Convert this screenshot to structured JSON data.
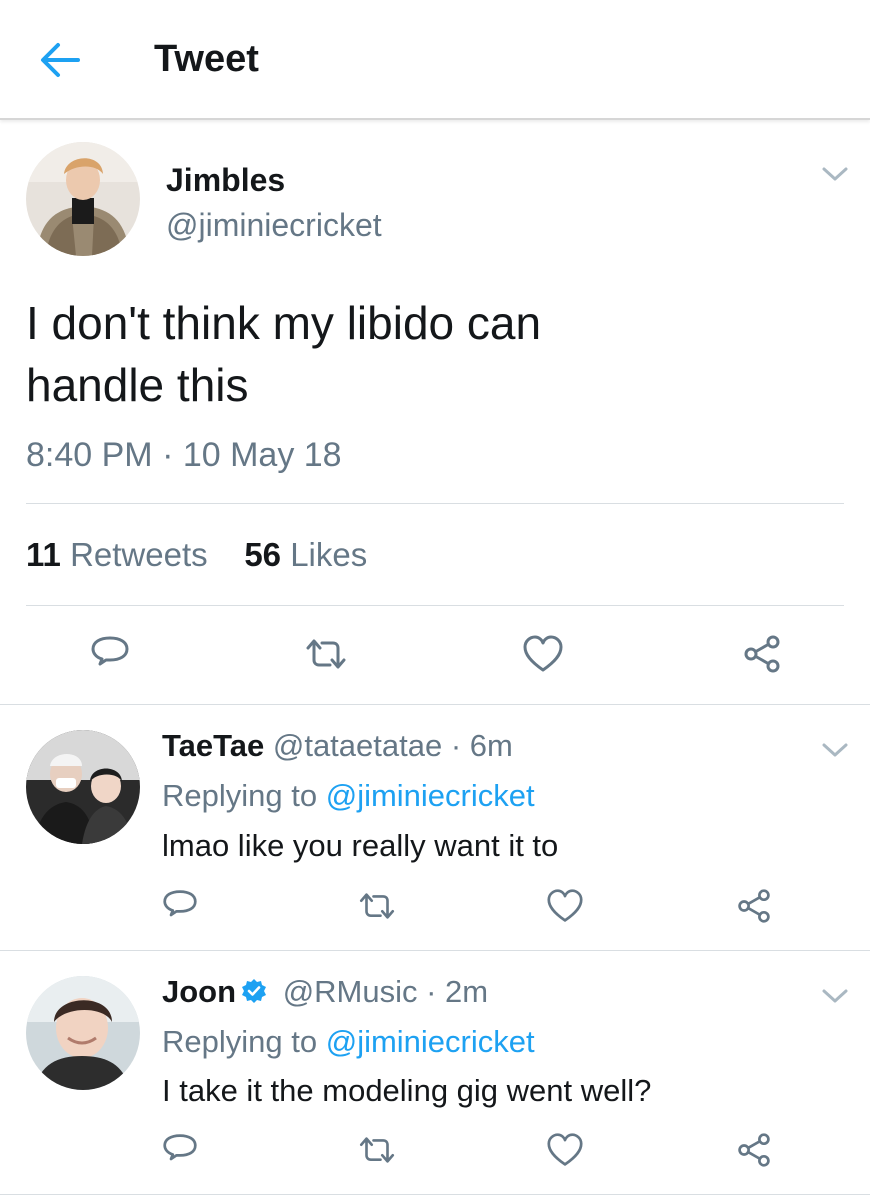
{
  "header": {
    "title": "Tweet",
    "back_icon": "arrow-left-icon",
    "accent": "#1da1f2"
  },
  "tweet": {
    "display_name": "Jimbles",
    "handle": "@jiminiecricket",
    "text_line1": "I don't think my libido can",
    "text_line2": "handle this",
    "timestamp": "8:40 PM · 10 May 18",
    "retweets_count": "11",
    "retweets_label": "Retweets",
    "likes_count": "56",
    "likes_label": "Likes"
  },
  "actions": [
    "reply-icon",
    "retweet-icon",
    "heart-icon",
    "share-icon"
  ],
  "replies": [
    {
      "name": "TaeTae",
      "handle": "@tataetatae",
      "time": "· 6m",
      "verified": false,
      "replying_prefix": "Replying to",
      "replying_to": "@jiminiecricket",
      "text": "lmao like you really want it to"
    },
    {
      "name": "Joon",
      "handle": "@RMusic",
      "time": "· 2m",
      "verified": true,
      "replying_prefix": "Replying to",
      "replying_to": "@jiminiecricket",
      "text": "I take it the modeling gig went well?"
    }
  ],
  "colors": {
    "text": "#14171a",
    "secondary": "#657786",
    "link": "#1da1f2",
    "divider": "#d9dee2"
  }
}
